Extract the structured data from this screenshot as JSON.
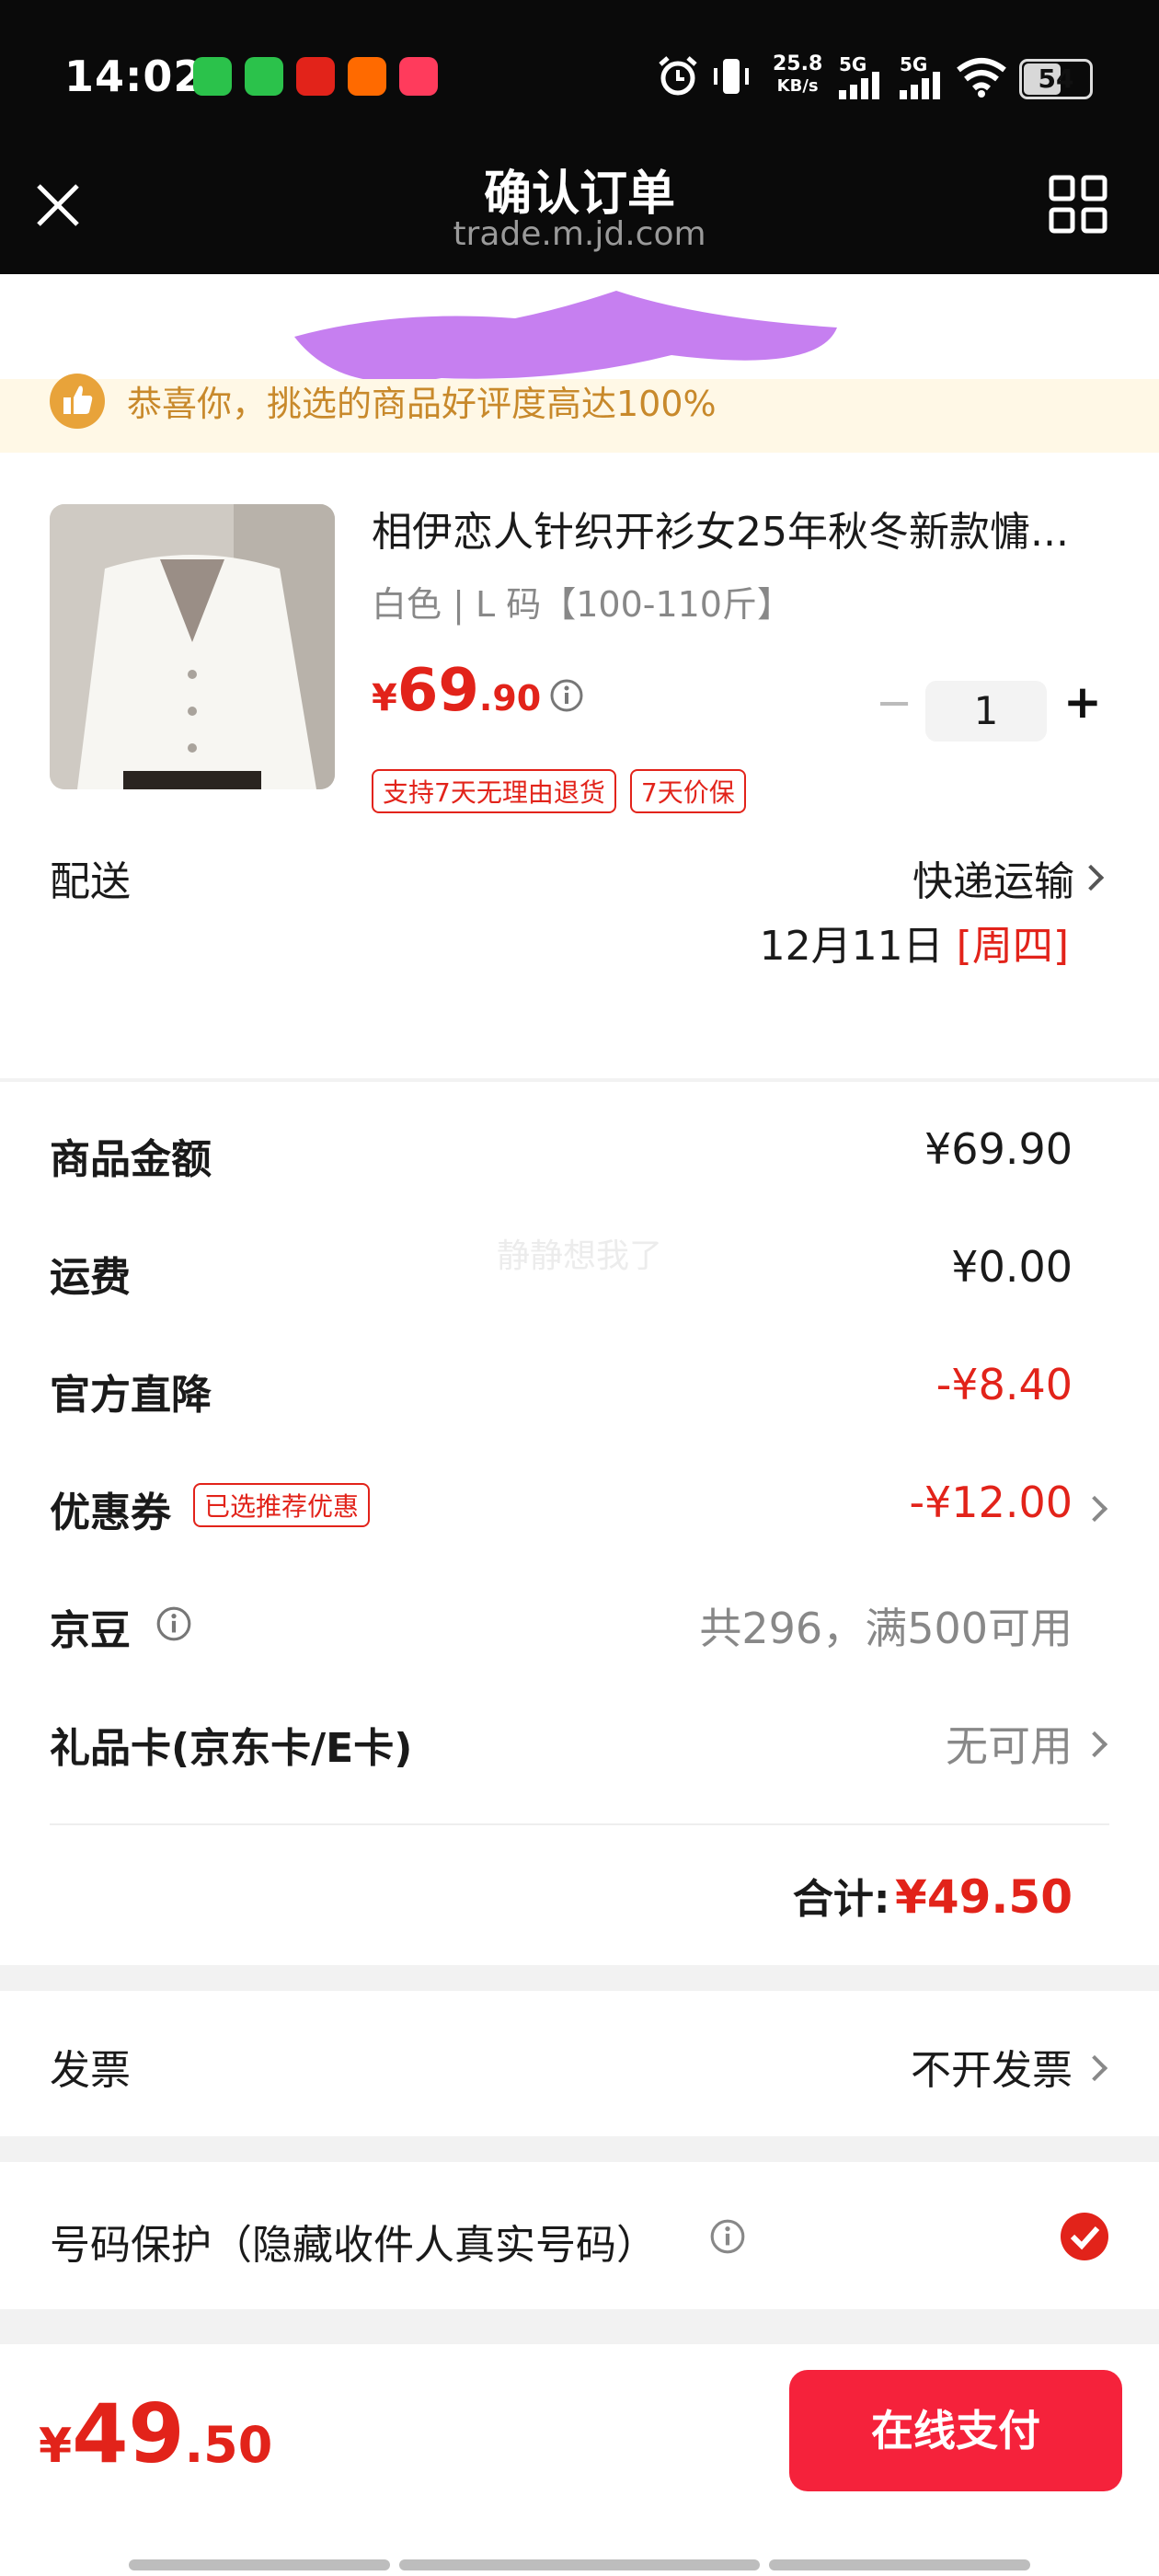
{
  "status_bar": {
    "time": "14:02",
    "speed_top": "25.8",
    "speed_bottom": "KB/s",
    "net1": "5G",
    "net2": "5G",
    "battery": "54",
    "app_icons": [
      "wechat-icon",
      "phone-icon",
      "red-app-icon",
      "taobao-icon",
      "meituan-icon"
    ]
  },
  "header": {
    "title": "确认订单",
    "domain": "trade.m.jd.com"
  },
  "tips": {
    "text": "恭喜你，挑选的商品好评度高达100%"
  },
  "product": {
    "name": "相伊恋人针织开衫女25年秋冬新款慵...",
    "spec": "白色 | L 码【100-110斤】",
    "price_symbol": "¥",
    "price_int": "69",
    "price_dec": ".90",
    "quantity": "1",
    "minus": "−",
    "plus": "+",
    "tags": [
      "支持7天无理由退货",
      "7天价保"
    ]
  },
  "delivery": {
    "label": "配送",
    "method": "快递运输",
    "date": "12月11日",
    "weekday": "[周四]"
  },
  "watermark": "静静想我了",
  "summary": {
    "goods_label": "商品金额",
    "goods_value": "¥69.90",
    "freight_label": "运费",
    "freight_value": "¥0.00",
    "discount_label": "官方直降",
    "discount_value": "-¥8.40",
    "coupon_label": "优惠券",
    "coupon_tag": "已选推荐优惠",
    "coupon_value": "-¥12.00",
    "beans_label": "京豆",
    "beans_value": "共296，满500可用",
    "giftcard_label": "礼品卡(京东卡/E卡)",
    "giftcard_value": "无可用",
    "total_label": "合计:",
    "total_value": "¥49.50"
  },
  "invoice": {
    "label": "发票",
    "value": "不开发票"
  },
  "privacy": {
    "label": "号码保护（隐藏收件人真实号码）",
    "checked": true
  },
  "footer": {
    "price_symbol": "¥",
    "price_int": "49",
    "price_dec": ".50",
    "pay_label": "在线支付"
  },
  "colors": {
    "accent": "#e2231a",
    "pay_button": "#f5223b",
    "tips_text": "#c8892b",
    "tips_bg": "#fff8e6"
  }
}
